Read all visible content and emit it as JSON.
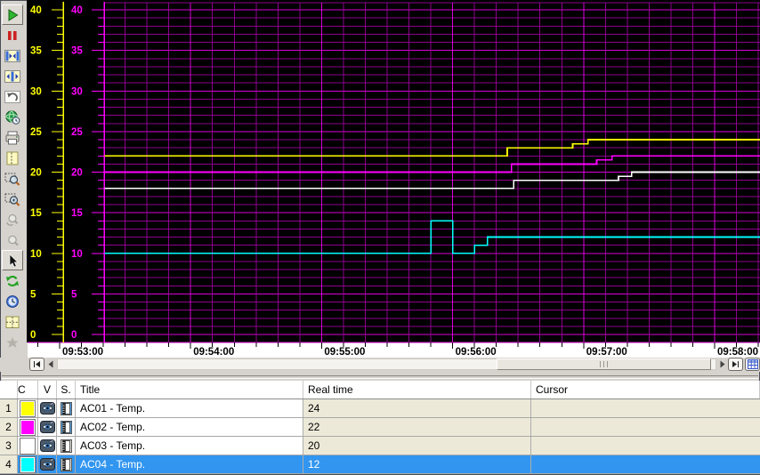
{
  "window": {
    "kind": "online-trend-control"
  },
  "toolbar": {
    "buttons": [
      {
        "icon": "start-icon",
        "pressed": true,
        "disabled": false
      },
      {
        "icon": "pause-icon",
        "pressed": false,
        "disabled": false
      },
      {
        "icon": "compress-time-axis-icon",
        "pressed": false,
        "disabled": false
      },
      {
        "icon": "expand-time-axis-icon",
        "pressed": false,
        "disabled": false
      },
      {
        "icon": "undo-icon",
        "pressed": false,
        "disabled": false
      },
      {
        "icon": "select-time-range-icon",
        "pressed": false,
        "disabled": false
      },
      {
        "icon": "print-icon",
        "pressed": false,
        "disabled": false
      },
      {
        "icon": "report-page-icon",
        "pressed": false,
        "disabled": false
      },
      {
        "icon": "zoom-area-icon",
        "pressed": false,
        "disabled": false
      },
      {
        "icon": "zoom-plus-minus-icon",
        "pressed": false,
        "disabled": false
      },
      {
        "icon": "undo-zoom-icon",
        "pressed": false,
        "disabled": true
      },
      {
        "icon": "original-view-icon",
        "pressed": false,
        "disabled": true
      },
      {
        "icon": "select-cursor-icon",
        "pressed": true,
        "disabled": false
      },
      {
        "icon": "refresh-icon",
        "pressed": false,
        "disabled": false
      },
      {
        "icon": "time-base-icon",
        "pressed": false,
        "disabled": false
      },
      {
        "icon": "coordinate-crosshair-icon",
        "pressed": false,
        "disabled": false
      },
      {
        "icon": "stats-icon",
        "pressed": false,
        "disabled": true
      }
    ]
  },
  "chart_data": {
    "type": "line",
    "title": "",
    "bg": "#000000",
    "grid": {
      "major_color": "#d800d8",
      "minor_color": "#8d008d",
      "visible": true
    },
    "x_axis": {
      "tick_labels": [
        "09:53:00",
        "09:54:00",
        "09:55:00",
        "09:56:00",
        "09:57:00",
        "09:58:00"
      ],
      "minor_tick_seconds": 10,
      "major_tick_seconds": 60,
      "label_color": "#000000",
      "strip_bg": "#ffffff"
    },
    "y_axes": [
      {
        "color": "#ffff00",
        "min": 0,
        "max": 40,
        "major_step": 5,
        "minor_step": 1,
        "tick_labels": [
          "0",
          "5",
          "10",
          "15",
          "20",
          "25",
          "30",
          "35",
          "40"
        ]
      },
      {
        "color": "#ff00ff",
        "min": 0,
        "max": 40,
        "major_step": 5,
        "minor_step": 1,
        "tick_labels": [
          "0",
          "5",
          "10",
          "15",
          "20",
          "25",
          "30",
          "35",
          "40"
        ]
      }
    ],
    "series": [
      {
        "name": "AC01 - Temp.",
        "color": "#ffff00",
        "points_sec_value": [
          [
            0,
            22
          ],
          [
            205,
            22
          ],
          [
            205,
            23
          ],
          [
            235,
            23
          ],
          [
            235,
            23.5
          ],
          [
            242,
            23.5
          ],
          [
            242,
            24
          ],
          [
            321,
            24
          ]
        ]
      },
      {
        "name": "AC02 - Temp.",
        "color": "#ff00ff",
        "points_sec_value": [
          [
            0,
            20
          ],
          [
            207,
            20
          ],
          [
            207,
            21
          ],
          [
            246,
            21
          ],
          [
            246,
            21.5
          ],
          [
            253,
            21.5
          ],
          [
            253,
            22
          ],
          [
            321,
            22
          ]
        ]
      },
      {
        "name": "AC03 - Temp.",
        "color": "#ffffff",
        "points_sec_value": [
          [
            0,
            18
          ],
          [
            208,
            18
          ],
          [
            208,
            19
          ],
          [
            256,
            19
          ],
          [
            256,
            19.5
          ],
          [
            262,
            19.5
          ],
          [
            262,
            20
          ],
          [
            321,
            20
          ]
        ]
      },
      {
        "name": "AC04 - Temp.",
        "color": "#00ffff",
        "points_sec_value": [
          [
            0,
            10
          ],
          [
            170,
            10
          ],
          [
            170,
            14
          ],
          [
            180,
            14
          ],
          [
            180,
            10
          ],
          [
            190,
            10
          ],
          [
            190,
            11
          ],
          [
            196,
            11
          ],
          [
            196,
            12
          ],
          [
            321,
            12
          ]
        ]
      }
    ]
  },
  "scrollbar": {
    "icons": [
      "go-to-start-icon",
      "scroll-left-icon",
      "scroll-right-icon",
      "go-to-end-icon",
      "toggle-table-icon"
    ]
  },
  "table": {
    "headers": [
      "",
      "C",
      "V",
      "S.",
      "Title",
      "Real time",
      "Cursor"
    ],
    "rows": [
      {
        "num": "1",
        "color": "#ffff00",
        "eye": true,
        "scale_pressed": true,
        "selected": false,
        "title": "AC01 - Temp.",
        "real_time": "24",
        "cursor": ""
      },
      {
        "num": "2",
        "color": "#ff00ff",
        "eye": true,
        "scale_pressed": true,
        "selected": false,
        "title": "AC02 - Temp.",
        "real_time": "22",
        "cursor": ""
      },
      {
        "num": "3",
        "color": "#ffffff",
        "eye": true,
        "scale_pressed": false,
        "selected": false,
        "title": "AC03 - Temp.",
        "real_time": "20",
        "cursor": ""
      },
      {
        "num": "4",
        "color": "#00ffff",
        "eye": true,
        "scale_pressed": false,
        "selected": true,
        "title": "AC04 - Temp.",
        "real_time": "12",
        "cursor": ""
      }
    ],
    "selection_color": "#3296f0"
  }
}
